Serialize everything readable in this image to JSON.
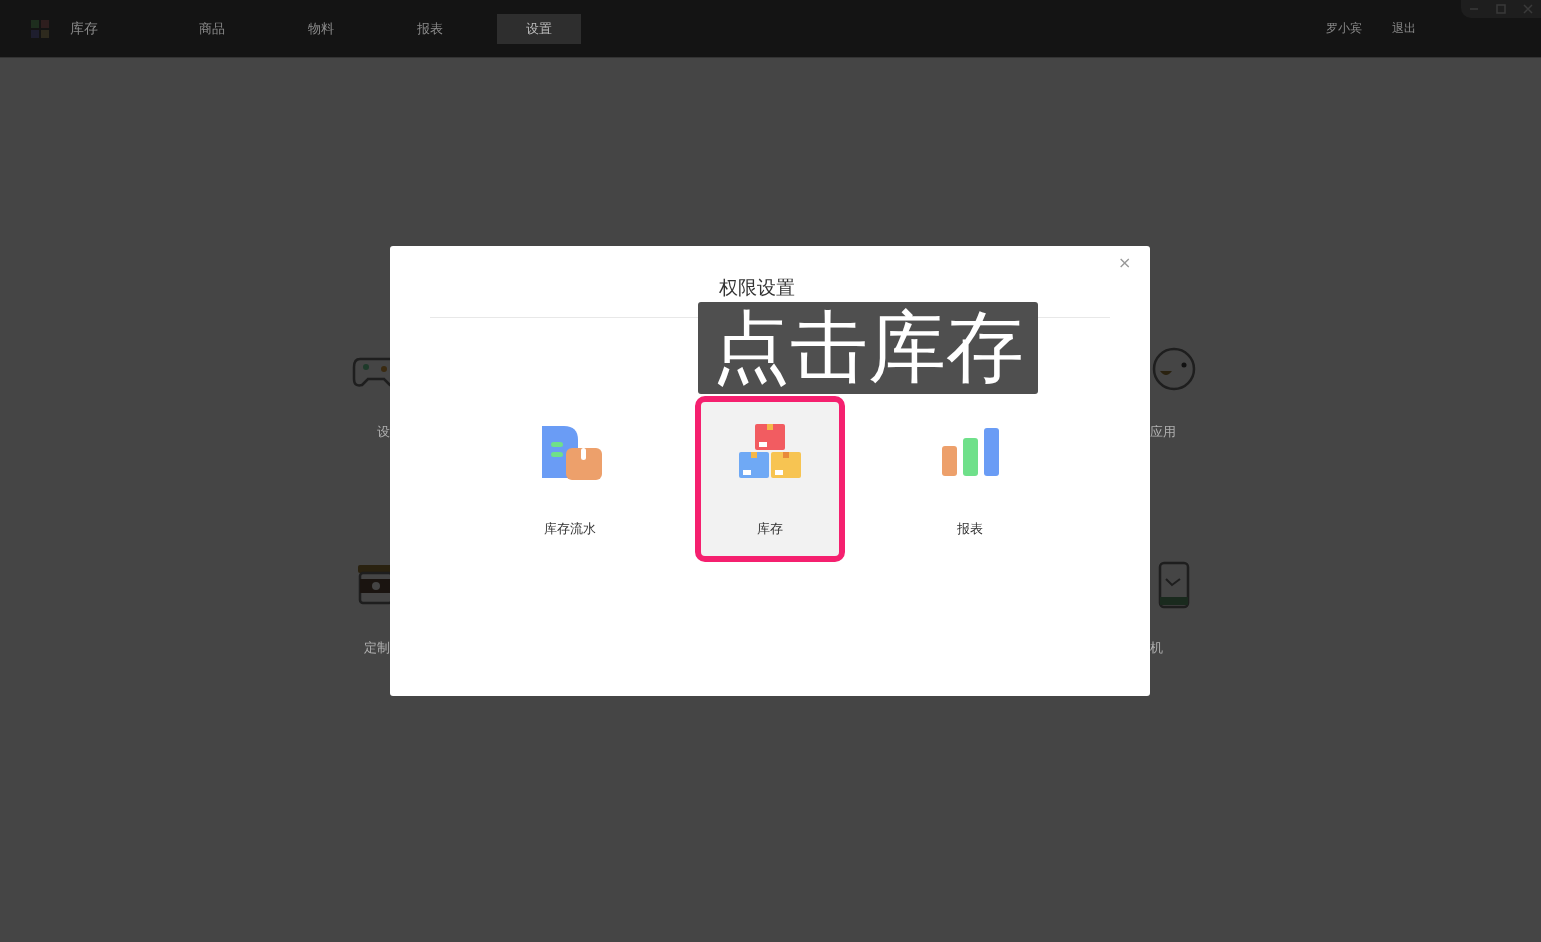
{
  "top_bar": {
    "app_name": "库存",
    "tabs": [
      {
        "label": "商品",
        "selected": false
      },
      {
        "label": "物料",
        "selected": false
      },
      {
        "label": "报表",
        "selected": false
      },
      {
        "label": "设置",
        "selected": true
      }
    ],
    "user": "罗小宾",
    "logout": "退出"
  },
  "background_apps": {
    "left": [
      {
        "kind": "gamepad",
        "label": "设"
      },
      {
        "kind": "coffee",
        "label": "定制"
      }
    ],
    "right": [
      {
        "kind": "face",
        "label": "应用"
      },
      {
        "kind": "phone",
        "label": "机"
      }
    ]
  },
  "dialog": {
    "title": "权限设置",
    "close": "×",
    "items": [
      {
        "kind": "flow",
        "label": "库存流水",
        "selected": false
      },
      {
        "kind": "boxes",
        "label": "库存",
        "selected": true
      },
      {
        "kind": "chart",
        "label": "报表",
        "selected": false
      }
    ]
  },
  "hint": "点击库存"
}
